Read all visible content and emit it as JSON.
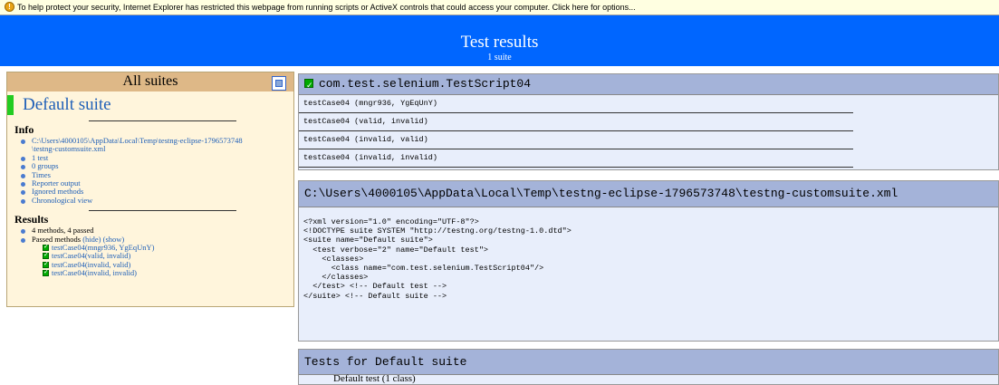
{
  "ie_bar": {
    "message": "To help protect your security, Internet Explorer has restricted this webpage from running scripts or ActiveX controls that could access your computer. Click here for options..."
  },
  "header": {
    "title": "Test results",
    "subtitle": "1 suite"
  },
  "nav": {
    "all_suites": "All suites",
    "suite_name": "Default suite",
    "info_title": "Info",
    "info_links": [
      "C:\\Users\\4000105\\AppData\\Local\\Temp\\testng-eclipse-1796573748",
      "\\testng-customsuite.xml",
      "1 test",
      "0 groups",
      "Times",
      "Reporter output",
      "Ignored methods",
      "Chronological view"
    ],
    "results_title": "Results",
    "results_summary": "4 methods, 4 passed",
    "passed_label": "Passed methods",
    "hide_label": "(hide)",
    "show_label": "(show)",
    "passed_methods": [
      "testCase04(mngr936, YgEqUnY)",
      "testCase04(valid, invalid)",
      "testCase04(invalid, valid)",
      "testCase04(invalid, invalid)"
    ]
  },
  "main": {
    "class_panel": {
      "title": "com.test.selenium.TestScript04",
      "rows": [
        "testCase04 (mngr936, YgEqUnY)",
        "testCase04 (valid, invalid)",
        "testCase04 (invalid, valid)",
        "testCase04 (invalid, invalid)"
      ]
    },
    "xml_panel": {
      "title": "C:\\Users\\4000105\\AppData\\Local\\Temp\\testng-eclipse-1796573748\\testng-customsuite.xml",
      "content": "<?xml version=\"1.0\" encoding=\"UTF-8\"?>\n<!DOCTYPE suite SYSTEM \"http://testng.org/testng-1.0.dtd\">\n<suite name=\"Default suite\">\n  <test verbose=\"2\" name=\"Default test\">\n    <classes>\n      <class name=\"com.test.selenium.TestScript04\"/>\n    </classes>\n  </test> <!-- Default test -->\n</suite> <!-- Default suite -->"
    },
    "tests_panel": {
      "title": "Tests for Default suite",
      "partial": "Default test (1 class)"
    }
  },
  "colors": {
    "header_bg": "#0066ff",
    "nav_bg": "#fff5dc",
    "nav_title_bg": "#deb887",
    "suite_bar": "#22cc22",
    "panel_head_bg": "#a4b3d9",
    "panel_bg": "#e8eefb",
    "pass_check": "#00aa00"
  },
  "icons": {
    "ie_bar": "shield-warning-icon",
    "collapse": "collapse-icon",
    "pass": "checkmark-icon"
  }
}
